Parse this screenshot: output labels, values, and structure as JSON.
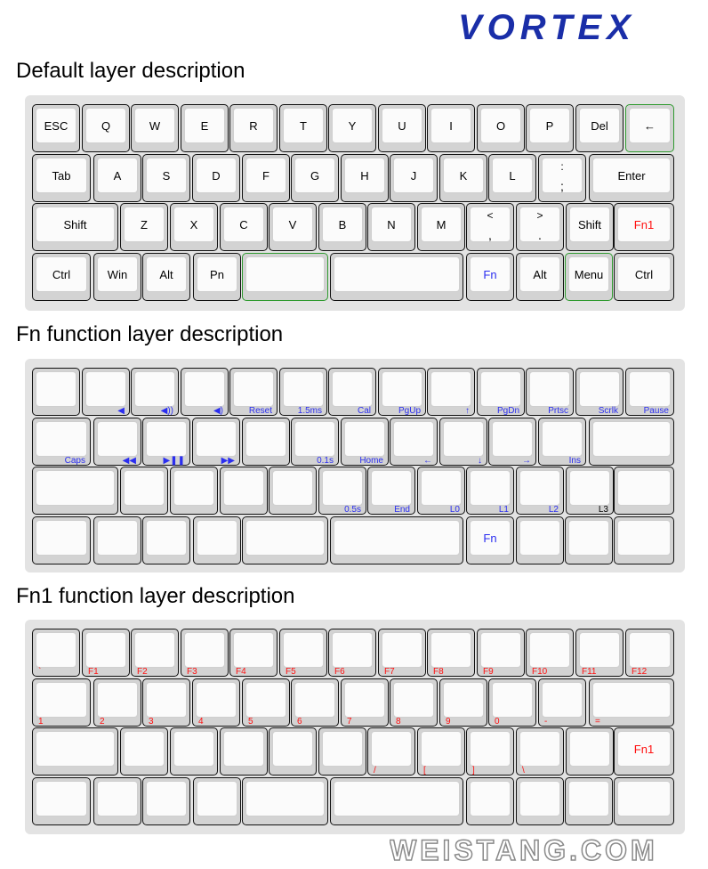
{
  "brand": "VORTEX",
  "footer": "WEISTANG.COM",
  "layers": [
    {
      "title": "Default layer description",
      "rows": [
        [
          {
            "main": "ESC"
          },
          {
            "main": "Q"
          },
          {
            "main": "W"
          },
          {
            "main": "E"
          },
          {
            "main": "R"
          },
          {
            "main": "T"
          },
          {
            "main": "Y"
          },
          {
            "main": "U"
          },
          {
            "main": "I"
          },
          {
            "main": "O"
          },
          {
            "main": "P"
          },
          {
            "main": "Del"
          },
          {
            "main": "←"
          }
        ],
        [
          {
            "main": "Tab"
          },
          {
            "main": "A"
          },
          {
            "main": "S"
          },
          {
            "main": "D"
          },
          {
            "main": "F"
          },
          {
            "main": "G"
          },
          {
            "main": "H"
          },
          {
            "main": "J"
          },
          {
            "main": "K"
          },
          {
            "main": "L"
          },
          {
            "top": ":",
            "bottom": ";"
          },
          {
            "main": "Enter"
          }
        ],
        [
          {
            "main": "Shift"
          },
          {
            "main": "Z"
          },
          {
            "main": "X"
          },
          {
            "main": "C"
          },
          {
            "main": "V"
          },
          {
            "main": "B"
          },
          {
            "main": "N"
          },
          {
            "main": "M"
          },
          {
            "top": "<",
            "bottom": ","
          },
          {
            "top": ">",
            "bottom": "."
          },
          {
            "main": "Shift"
          },
          {
            "main": "Fn1",
            "color": "red"
          }
        ],
        [
          {
            "main": "Ctrl"
          },
          {
            "main": "Win"
          },
          {
            "main": "Alt"
          },
          {
            "main": "Pn"
          },
          {
            "main": ""
          },
          {
            "main": ""
          },
          {
            "main": "Fn",
            "color": "blue"
          },
          {
            "main": "Alt"
          },
          {
            "main": "Menu"
          },
          {
            "main": "Ctrl"
          }
        ]
      ]
    },
    {
      "title": "Fn function layer description",
      "rows": [
        [
          {
            "sub": ""
          },
          {
            "sub": "◀"
          },
          {
            "sub": "◀))"
          },
          {
            "sub": "◀)"
          },
          {
            "sub": "Reset"
          },
          {
            "sub": "1.5ms"
          },
          {
            "sub": "Cal"
          },
          {
            "sub": "PgUp"
          },
          {
            "sub": "↑"
          },
          {
            "sub": "PgDn"
          },
          {
            "sub": "Prtsc"
          },
          {
            "sub": "Scrlk"
          },
          {
            "sub": "Pause"
          }
        ],
        [
          {
            "sub": "Caps"
          },
          {
            "sub": "◀◀"
          },
          {
            "sub": "▶❚❚"
          },
          {
            "sub": "▶▶"
          },
          {
            "sub": ""
          },
          {
            "sub": "0.1s"
          },
          {
            "sub": "Home"
          },
          {
            "sub": "←"
          },
          {
            "sub": "↓"
          },
          {
            "sub": "→"
          },
          {
            "sub": "Ins"
          },
          {
            "sub": ""
          }
        ],
        [
          {
            "sub": ""
          },
          {
            "sub": ""
          },
          {
            "sub": ""
          },
          {
            "sub": ""
          },
          {
            "sub": ""
          },
          {
            "sub": "0.5s"
          },
          {
            "sub": "End"
          },
          {
            "sub": "L0"
          },
          {
            "sub": "L1"
          },
          {
            "sub": "L2"
          },
          {
            "sub": "L3",
            "color": "black"
          },
          {
            "sub": ""
          }
        ],
        [
          {
            "sub": ""
          },
          {
            "sub": ""
          },
          {
            "sub": ""
          },
          {
            "sub": ""
          },
          {
            "sub": ""
          },
          {
            "sub": ""
          },
          {
            "main": "Fn",
            "color": "blue"
          },
          {
            "sub": ""
          },
          {
            "sub": ""
          },
          {
            "sub": ""
          }
        ]
      ]
    },
    {
      "title": "Fn1 function layer description",
      "rows": [
        [
          {
            "sub": "`"
          },
          {
            "sub": "F1"
          },
          {
            "sub": "F2"
          },
          {
            "sub": "F3"
          },
          {
            "sub": "F4"
          },
          {
            "sub": "F5"
          },
          {
            "sub": "F6"
          },
          {
            "sub": "F7"
          },
          {
            "sub": "F8"
          },
          {
            "sub": "F9"
          },
          {
            "sub": "F10"
          },
          {
            "sub": "F11"
          },
          {
            "sub": "F12"
          }
        ],
        [
          {
            "sub": "1"
          },
          {
            "sub": "2"
          },
          {
            "sub": "3"
          },
          {
            "sub": "4"
          },
          {
            "sub": "5"
          },
          {
            "sub": "6"
          },
          {
            "sub": "7"
          },
          {
            "sub": "8"
          },
          {
            "sub": "9"
          },
          {
            "sub": "0"
          },
          {
            "sub": "-"
          },
          {
            "sub": "="
          }
        ],
        [
          {
            "sub": ""
          },
          {
            "sub": ""
          },
          {
            "sub": ""
          },
          {
            "sub": ""
          },
          {
            "sub": ""
          },
          {
            "sub": ""
          },
          {
            "sub": "/"
          },
          {
            "sub": "["
          },
          {
            "sub": "]"
          },
          {
            "sub": "\\"
          },
          {
            "sub": ""
          },
          {
            "main": "Fn1",
            "color": "red"
          }
        ],
        [
          {
            "sub": ""
          },
          {
            "sub": ""
          },
          {
            "sub": ""
          },
          {
            "sub": ""
          },
          {
            "sub": ""
          },
          {
            "sub": ""
          },
          {
            "sub": ""
          },
          {
            "sub": ""
          },
          {
            "sub": ""
          },
          {
            "sub": ""
          }
        ]
      ]
    }
  ]
}
